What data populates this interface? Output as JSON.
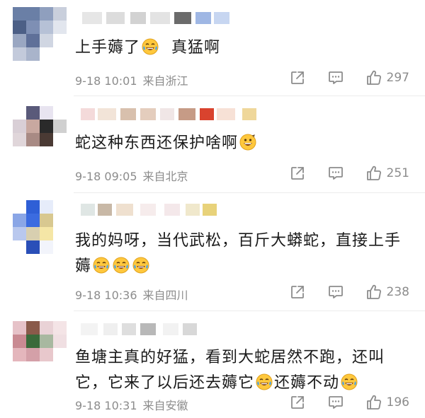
{
  "comments": [
    {
      "text_a": "上手薅了",
      "text_b": "真猛啊",
      "date": "9-18 10:01",
      "location": "来自浙江",
      "likes": "297"
    },
    {
      "text_a": "蛇这种东西还保护啥啊",
      "date": "9-18 09:05",
      "location": "来自北京",
      "likes": "251"
    },
    {
      "text_line1": "我的妈呀，当代武松，百斤大蟒蛇，直接上手",
      "text_line2": "薅",
      "date": "9-18 10:36",
      "location": "来自四川",
      "likes": "238"
    },
    {
      "text_line1": "鱼塘主真的好猛，看到大蛇居然不跑，还叫",
      "text_line2a": "它，它来了以后还去薅它",
      "text_line2b": "还薅不动",
      "date": "9-18 10:31",
      "location": "来自安徽",
      "likes": "196"
    }
  ],
  "icons": {
    "share": "share-icon",
    "comment": "comment-icon",
    "like": "thumbs-up-icon",
    "emoji_cry_laugh": "tears-of-joy-emoji",
    "emoji_grin": "grinning-emoji"
  },
  "colors": {
    "meta_text": "#8c8c8c",
    "emoji_yellow": "#ffc83d",
    "emoji_tear": "#4aa3e8"
  }
}
